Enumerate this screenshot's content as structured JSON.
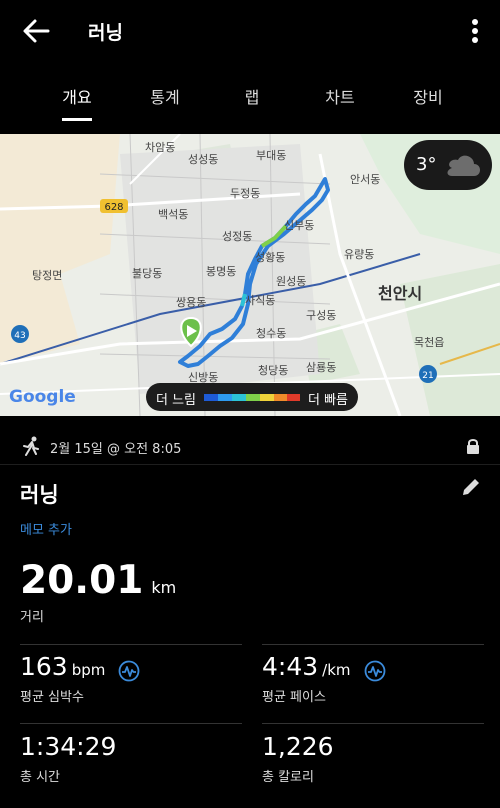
{
  "header": {
    "title": "러닝",
    "back_icon": "arrow-left-icon",
    "menu_icon": "more-vertical-icon"
  },
  "tabs": [
    {
      "label": "개요",
      "active": true
    },
    {
      "label": "통계",
      "active": false
    },
    {
      "label": "랩",
      "active": false
    },
    {
      "label": "차트",
      "active": false
    },
    {
      "label": "장비",
      "active": false
    }
  ],
  "map": {
    "weather": {
      "temp": "3°",
      "icon": "cloud-icon"
    },
    "legend": {
      "slow": "더 느림",
      "fast": "더 빠름",
      "colors": [
        "#1e5bd6",
        "#2e9bf0",
        "#2cc3d6",
        "#7fd04a",
        "#f0d23a",
        "#f08a2a",
        "#e03b2a"
      ]
    },
    "attribution": "Google",
    "road_badges": [
      "628",
      "43",
      "21"
    ],
    "places": [
      "차암동",
      "성성동",
      "부대동",
      "안서동",
      "두정동",
      "백석동",
      "신부동",
      "성정동",
      "유량동",
      "탕정면",
      "불당동",
      "봉명동",
      "성황동",
      "원성동",
      "천안시",
      "쌍용동",
      "사직동",
      "구성동",
      "청수동",
      "목천읍",
      "청당동",
      "삼룡동",
      "신방동"
    ]
  },
  "activity": {
    "date": "2월 15일 @ 오전 8:05",
    "name": "러닝",
    "memo": "메모 추가",
    "distance": {
      "value": "20.01",
      "unit": "km",
      "label": "거리"
    },
    "stats": [
      {
        "value": "163",
        "unit": "bpm",
        "label": "평균 심박수"
      },
      {
        "value": "4:43",
        "unit": "/km",
        "label": "평균 페이스"
      },
      {
        "value": "1:34:29",
        "unit": "",
        "label": "총 시간"
      },
      {
        "value": "1,226",
        "unit": "",
        "label": "총 칼로리"
      }
    ]
  },
  "colors": {
    "accent": "#3b8bdb",
    "route": "#2f7fd8",
    "start_pin": "#6cc04a"
  }
}
